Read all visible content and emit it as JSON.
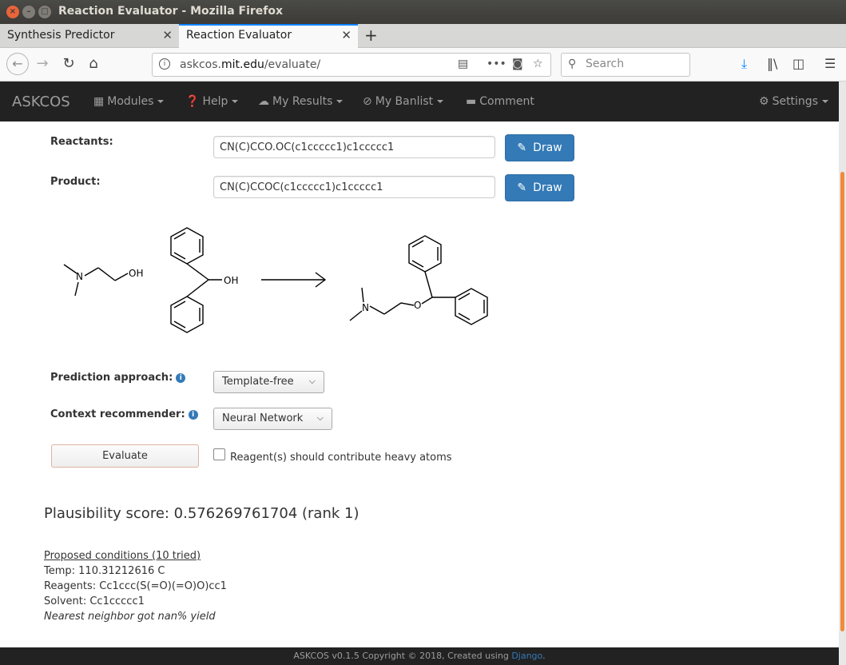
{
  "window": {
    "title": "Reaction Evaluator - Mozilla Firefox"
  },
  "browser": {
    "tabs": [
      {
        "label": "Synthesis Predictor",
        "active": false
      },
      {
        "label": "Reaction Evaluator",
        "active": true
      }
    ],
    "url_domain_prefix": "askcos.",
    "url_domain": "mit.edu",
    "url_path": "/evaluate/",
    "search_placeholder": "Search"
  },
  "navbar": {
    "brand": "ASKCOS",
    "items": [
      {
        "label": "Modules",
        "icon": "grid-icon"
      },
      {
        "label": "Help",
        "icon": "question-circle-icon"
      },
      {
        "label": "My Results",
        "icon": "cloud-icon"
      },
      {
        "label": "My Banlist",
        "icon": "ban-icon"
      },
      {
        "label": "Comment",
        "icon": "comment-icon"
      }
    ],
    "settings": "Settings"
  },
  "form": {
    "reactants_label": "Reactants:",
    "reactants_value": "CN(C)CCO.OC(c1ccccc1)c1ccccc1",
    "product_label": "Product:",
    "product_value": "CN(C)CCOC(c1ccccc1)c1ccccc1",
    "draw_label": "Draw",
    "approach_label": "Prediction approach:",
    "approach_value": "Template-free",
    "context_label": "Context recommender:",
    "context_value": "Neural Network",
    "evaluate_label": "Evaluate",
    "reagent_checkbox_label": "Reagent(s) should contribute heavy atoms",
    "reagent_checked": false
  },
  "structure": {
    "oh_label": "OH",
    "n_label": "N",
    "o_label": "O"
  },
  "results": {
    "score_text": "Plausibility score: 0.576269761704 (rank 1)",
    "conditions_header": "Proposed conditions (10 tried)",
    "temp": "Temp: 110.31212616 C",
    "reagents": "Reagents: Cc1ccc(S(=O)(=O)O)cc1",
    "solvent": "Solvent: Cc1ccccc1",
    "neighbor": "Nearest neighbor got nan% yield"
  },
  "footer": {
    "text": "ASKCOS v0.1.5 Copyright © 2018, Created using ",
    "link": "Django",
    "end": "."
  },
  "colors": {
    "primary": "#337ab7",
    "navbar": "#222222",
    "tab_accent": "#0a84ff"
  }
}
